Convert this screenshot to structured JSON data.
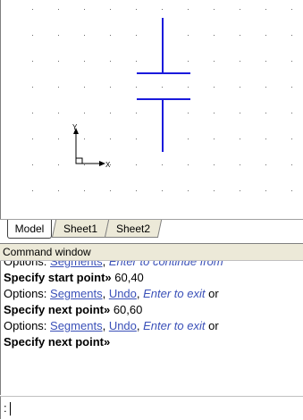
{
  "tabs": [
    {
      "label": "Model",
      "active": true
    },
    {
      "label": "Sheet1",
      "active": false
    },
    {
      "label": "Sheet2",
      "active": false
    }
  ],
  "ucs": {
    "y_label": "Y",
    "x_label": "X"
  },
  "drawing": {
    "line_color": "#1a1adc",
    "grid_color": "#6a6a6a"
  },
  "command_window": {
    "title": "Command window",
    "history": [
      {
        "parts": [
          {
            "t": "Options: ",
            "s": "plain"
          },
          {
            "t": "Segments",
            "s": "opt"
          },
          {
            "t": ", ",
            "s": "plain"
          },
          {
            "t": "Enter to continue from",
            "s": "hint"
          }
        ]
      },
      {
        "parts": [
          {
            "t": "Specify start point» ",
            "s": "bold"
          },
          {
            "t": "60,40",
            "s": "plain"
          }
        ]
      },
      {
        "parts": [
          {
            "t": "Options: ",
            "s": "plain"
          },
          {
            "t": "Segments",
            "s": "opt"
          },
          {
            "t": ", ",
            "s": "plain"
          },
          {
            "t": "Undo",
            "s": "opt"
          },
          {
            "t": ", ",
            "s": "plain"
          },
          {
            "t": "Enter to exit",
            "s": "hint"
          },
          {
            "t": " or",
            "s": "plain"
          }
        ]
      },
      {
        "parts": [
          {
            "t": "Specify next point» ",
            "s": "bold"
          },
          {
            "t": "60,60",
            "s": "plain"
          }
        ]
      },
      {
        "parts": [
          {
            "t": "Options: ",
            "s": "plain"
          },
          {
            "t": "Segments",
            "s": "opt"
          },
          {
            "t": ", ",
            "s": "plain"
          },
          {
            "t": "Undo",
            "s": "opt"
          },
          {
            "t": ", ",
            "s": "plain"
          },
          {
            "t": "Enter to exit",
            "s": "hint"
          },
          {
            "t": " or",
            "s": "plain"
          }
        ]
      },
      {
        "parts": [
          {
            "t": "Specify next point»",
            "s": "bold"
          }
        ]
      }
    ],
    "prompt": ":"
  }
}
